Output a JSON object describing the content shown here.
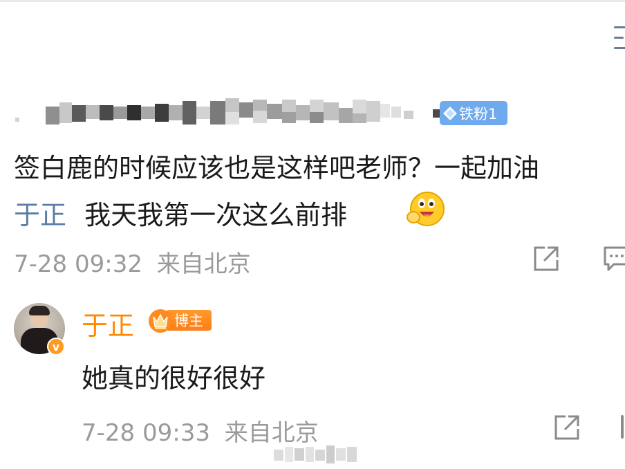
{
  "top_bar": {
    "menu_icon": "menu-icon"
  },
  "comment": {
    "username_redacted": true,
    "fan_badge": "铁粉1",
    "text_line1": "签白鹿的时候应该也是这样吧老师？一起加油",
    "mention": "于正",
    "text_line2": "我天我第一次这么前排",
    "emoji": "grinning-emoji",
    "timestamp": "7-28 09:32",
    "location": "来自北京",
    "actions": {
      "share_icon": "share-icon",
      "comment_icon": "comment-icon"
    }
  },
  "reply": {
    "author": "于正",
    "author_badge": "博主",
    "verified": "v",
    "text": "她真的很好很好",
    "timestamp": "7-28 09:33",
    "location": "来自北京",
    "actions": {
      "share_icon": "share-icon"
    }
  },
  "colors": {
    "accent_orange": "#ff8a00",
    "mention_blue": "#5c7ca8",
    "fan_badge_blue": "#6fa9ee",
    "meta_gray": "#9a9a9a"
  }
}
